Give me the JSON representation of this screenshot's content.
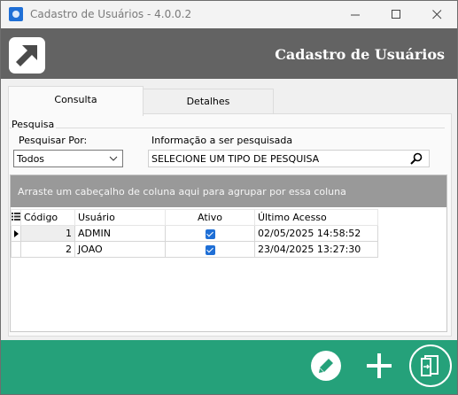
{
  "window": {
    "title": "Cadastro de Usuários - 4.0.0.2"
  },
  "banner": {
    "title": "Cadastro de Usuários"
  },
  "tabs": [
    {
      "label": "Consulta",
      "active": true
    },
    {
      "label": "Detalhes",
      "active": false
    }
  ],
  "search": {
    "group_label": "Pesquisa",
    "type_label": "Pesquisar Por:",
    "type_value": "Todos",
    "info_label": "Informação a ser pesquisada",
    "info_value": "SELECIONE UM TIPO DE PESQUISA"
  },
  "grid": {
    "group_hint": "Arraste um cabeçalho de coluna aqui para agrupar por essa coluna",
    "columns": [
      "Código",
      "Usuário",
      "Ativo",
      "Último Acesso"
    ],
    "rows": [
      {
        "codigo": "1",
        "usuario": "ADMIN",
        "ativo": true,
        "ultimo_acesso": "02/05/2025 14:58:52",
        "current": true
      },
      {
        "codigo": "2",
        "usuario": "JOAO",
        "ativo": true,
        "ultimo_acesso": "23/04/2025 13:27:30",
        "current": false
      }
    ]
  },
  "colors": {
    "footer": "#25a17a",
    "banner": "#636363",
    "accent": "#1f6fd6"
  },
  "icons": {
    "footer": [
      "pencil-icon",
      "plus-icon",
      "exit-icon"
    ]
  }
}
